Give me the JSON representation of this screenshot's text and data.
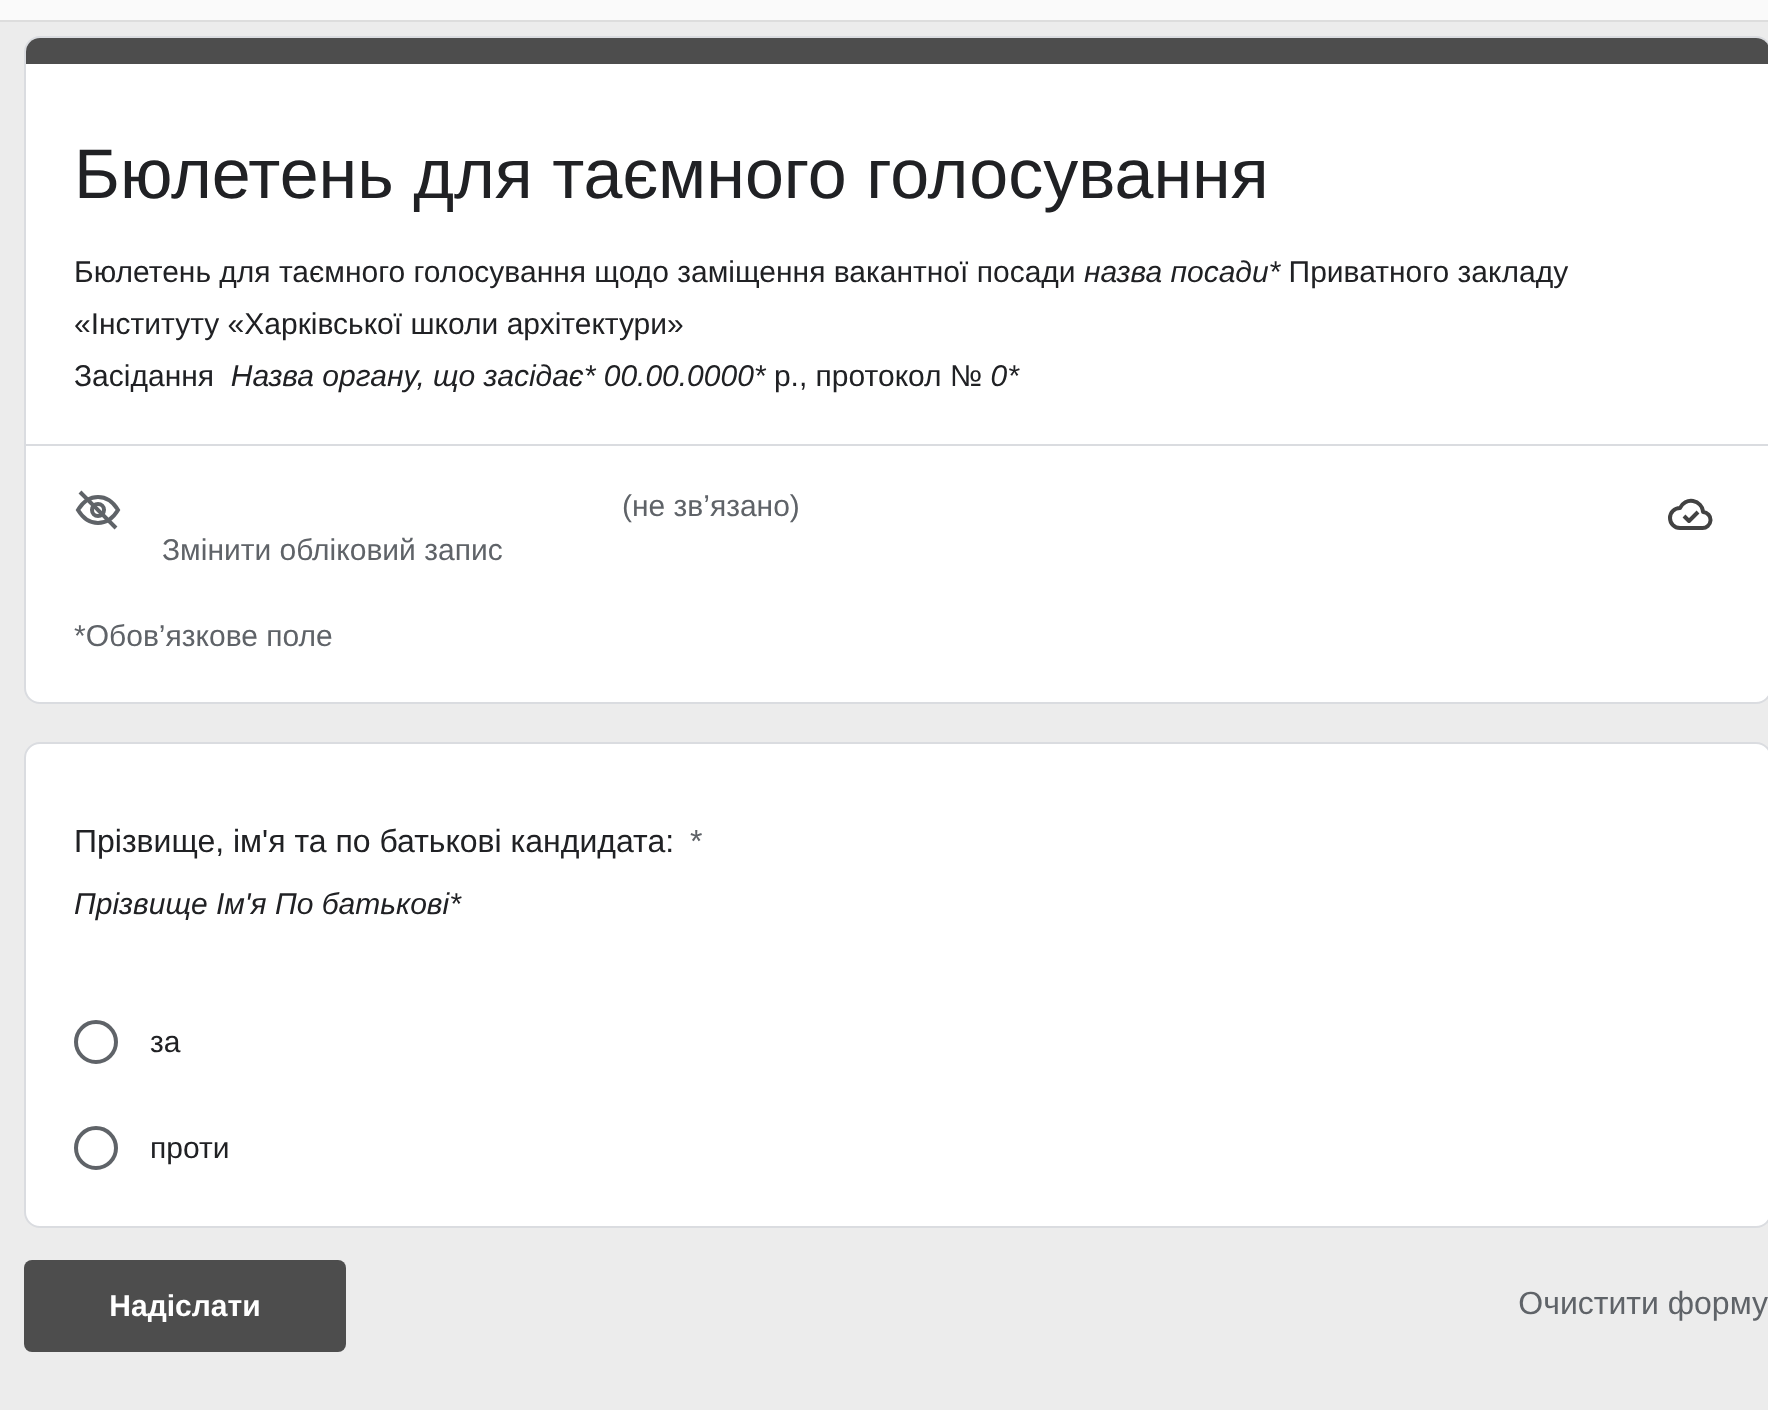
{
  "header": {
    "title": "Бюлетень для таємного голосування",
    "description": [
      [
        {
          "kind": "plain",
          "text": "Бюлетень для таємного голосування щодо заміщення вакантної посади "
        },
        {
          "kind": "italic",
          "text": "назва посади*"
        },
        {
          "kind": "plain",
          "text": " Приватного закладу «Інституту «Харківської школи архітектури»"
        }
      ],
      [
        {
          "kind": "plain",
          "text": "Засідання  "
        },
        {
          "kind": "italic",
          "text": "Назва органу, що засідає* 00.00.0000*"
        },
        {
          "kind": "plain",
          "text": " р., протокол № "
        },
        {
          "kind": "italic",
          "text": "0*"
        }
      ]
    ],
    "account_status": "(не зв’язано)",
    "switch_account": "Змінити обліковий запис",
    "required_note": "*Обов’язкове поле"
  },
  "question": {
    "title": "Прізвище, ім'я та по батькові кандидата:",
    "required_mark": "*",
    "subtitle": "Прізвище Ім'я По батькові*",
    "options": [
      {
        "label": "за",
        "selected": false
      },
      {
        "label": "проти",
        "selected": false
      }
    ]
  },
  "buttons": {
    "submit": "Надіслати",
    "clear": "Очистити форму"
  }
}
